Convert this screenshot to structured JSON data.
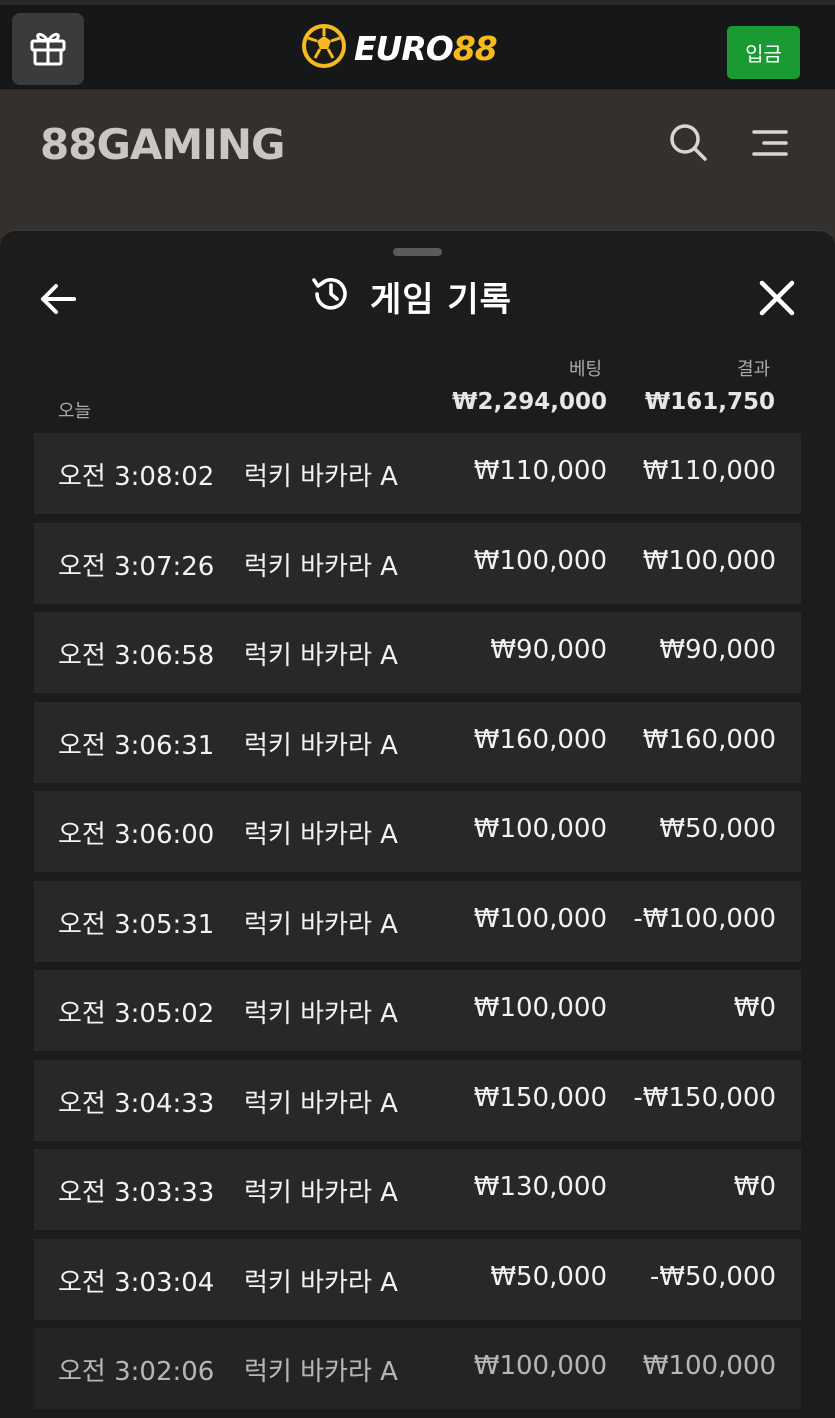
{
  "topbar": {
    "brand_left": "EURO",
    "brand_right": "88",
    "deposit_label": "입금",
    "icons": [
      "gift-icon",
      "soccer-ball-icon"
    ]
  },
  "game_header": {
    "logo_text": "88GAMING",
    "icons": [
      "search-icon",
      "hamburger-menu-icon"
    ]
  },
  "sheet": {
    "title": "게임 기록",
    "icons": [
      "back-arrow-icon",
      "history-icon",
      "close-icon"
    ],
    "today_label": "오늘",
    "bet_header": "베팅",
    "result_header": "결과",
    "total_bet": "₩2,294,000",
    "total_result": "₩161,750",
    "rows": [
      {
        "time": "오전 3:08:02",
        "game": "럭키 바카라 A",
        "bet": "₩110,000",
        "result": "₩110,000"
      },
      {
        "time": "오전 3:07:26",
        "game": "럭키 바카라 A",
        "bet": "₩100,000",
        "result": "₩100,000"
      },
      {
        "time": "오전 3:06:58",
        "game": "럭키 바카라 A",
        "bet": "₩90,000",
        "result": "₩90,000"
      },
      {
        "time": "오전 3:06:31",
        "game": "럭키 바카라 A",
        "bet": "₩160,000",
        "result": "₩160,000"
      },
      {
        "time": "오전 3:06:00",
        "game": "럭키 바카라 A",
        "bet": "₩100,000",
        "result": "₩50,000"
      },
      {
        "time": "오전 3:05:31",
        "game": "럭키 바카라 A",
        "bet": "₩100,000",
        "result": "-₩100,000"
      },
      {
        "time": "오전 3:05:02",
        "game": "럭키 바카라 A",
        "bet": "₩100,000",
        "result": "₩0"
      },
      {
        "time": "오전 3:04:33",
        "game": "럭키 바카라 A",
        "bet": "₩150,000",
        "result": "-₩150,000"
      },
      {
        "time": "오전 3:03:33",
        "game": "럭키 바카라 A",
        "bet": "₩130,000",
        "result": "₩0"
      },
      {
        "time": "오전 3:03:04",
        "game": "럭키 바카라 A",
        "bet": "₩50,000",
        "result": "-₩50,000"
      },
      {
        "time": "오전 3:02:06",
        "game": "럭키 바카라 A",
        "bet": "₩100,000",
        "result": "₩100,000"
      }
    ]
  },
  "colors": {
    "deposit_green": "#1a9a32",
    "brand_yellow": "#f6b91e",
    "row_bg": "#282829",
    "sheet_bg": "#1c1c1d"
  }
}
